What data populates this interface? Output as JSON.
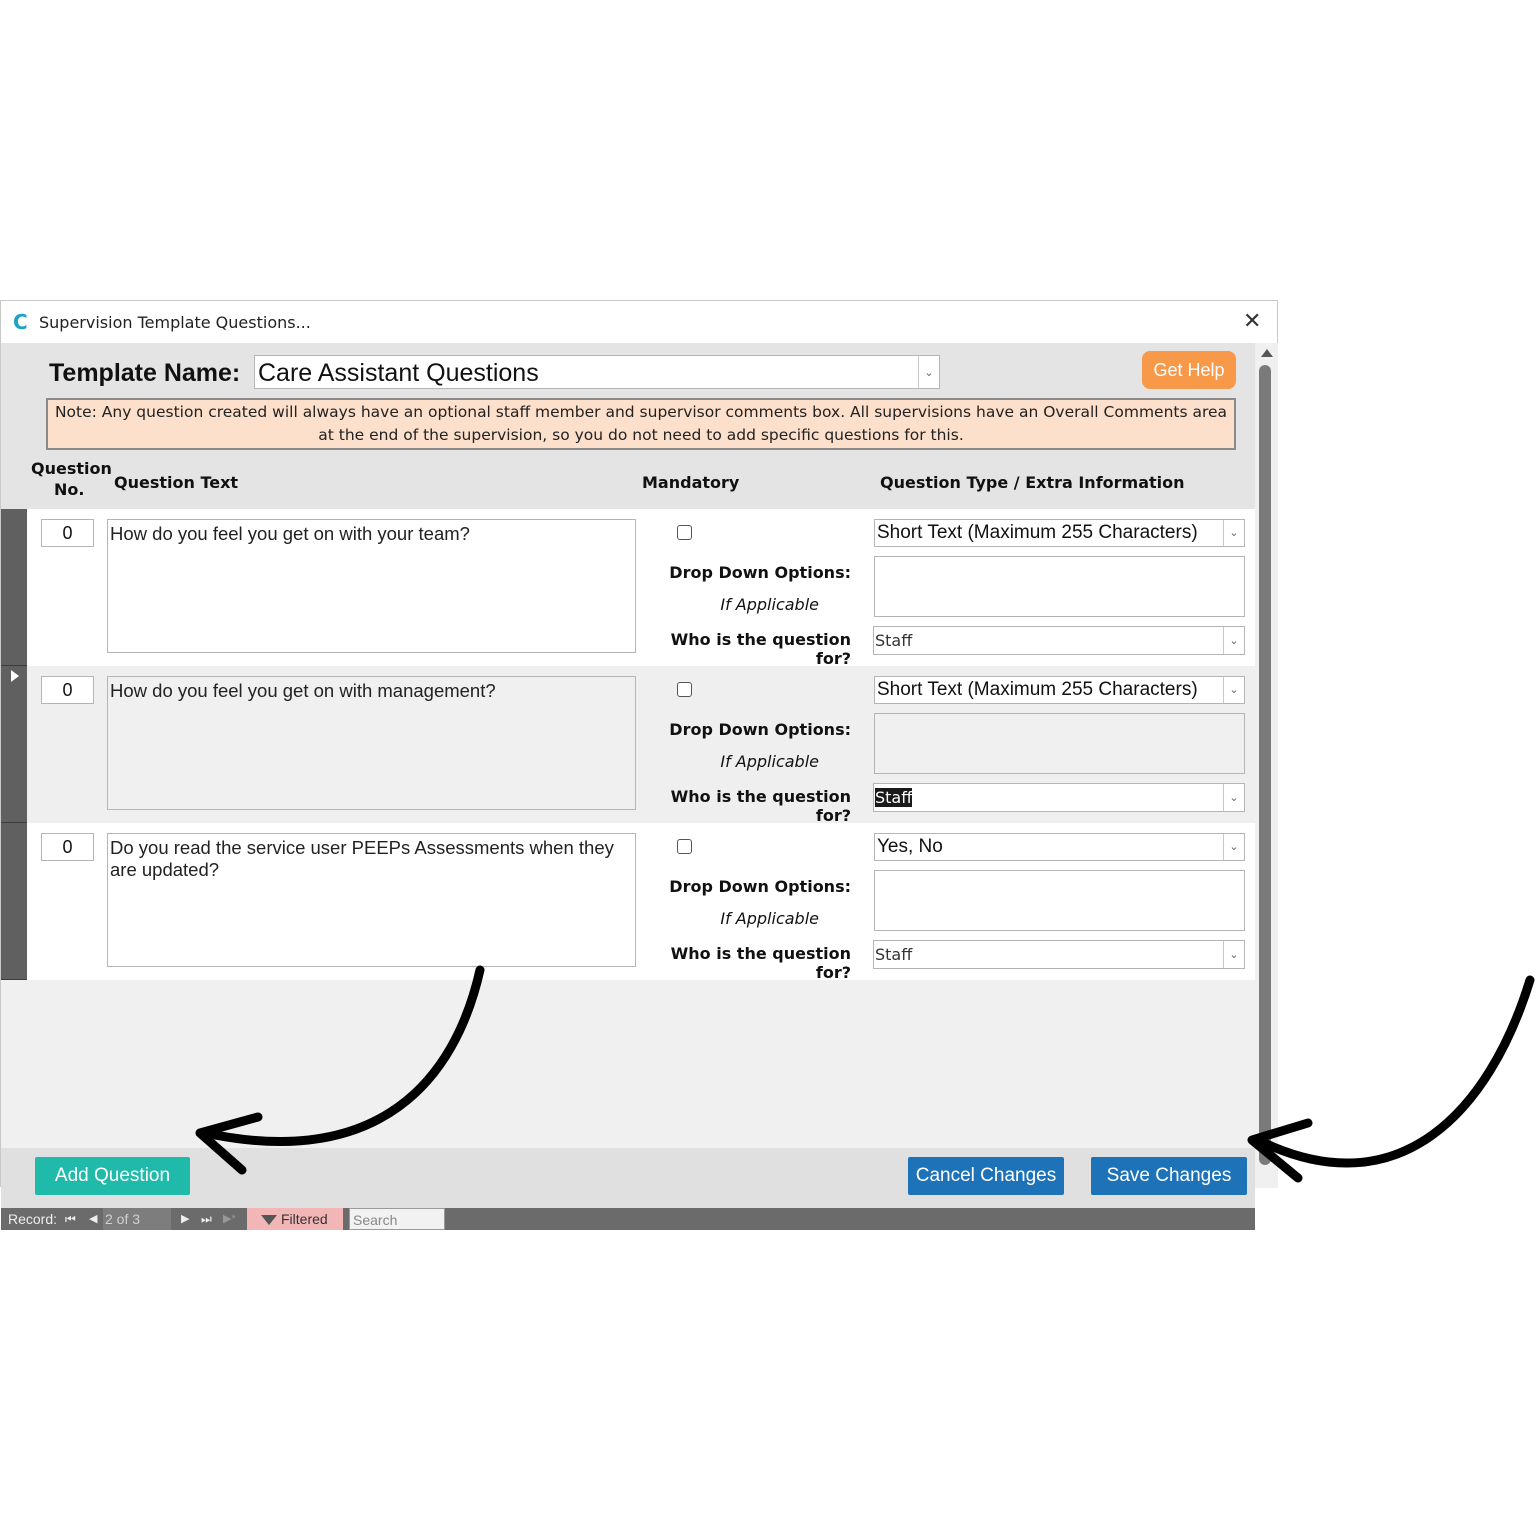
{
  "window": {
    "logo_letter": "C",
    "title": "Supervision Template Questions...",
    "close_glyph": "✕"
  },
  "header": {
    "template_label": "Template Name:",
    "template_value": "Care Assistant Questions",
    "help_label": "Get Help",
    "note": "Note: Any question created will always have an optional staff member and supervisor comments box.  All supervisions have an Overall Comments area at the end of the supervision, so you do not need to add specific questions for this.",
    "columns": {
      "question_no_1": "Question",
      "question_no_2": "No.",
      "question_text": "Question Text",
      "mandatory": "Mandatory",
      "question_type": "Question Type / Extra Information"
    }
  },
  "row_labels": {
    "dropdown_options": "Drop Down Options:",
    "if_applicable": "If Applicable",
    "who_for": "Who is the question for?"
  },
  "rows": [
    {
      "no": "0",
      "text": "How do you feel you get on with your team?",
      "mandatory": false,
      "type": "Short Text (Maximum 255 Characters)",
      "options": "",
      "who": "Staff"
    },
    {
      "no": "0",
      "text": "How do you feel you get on with management?",
      "mandatory": false,
      "type": "Short Text (Maximum 255 Characters)",
      "options": "",
      "who": "Staff"
    },
    {
      "no": "0",
      "text": "Do you read the service user PEEPs Assessments when they are updated?",
      "mandatory": false,
      "type": "Yes, No",
      "options": "",
      "who": "Staff"
    }
  ],
  "footer": {
    "add_label": "Add Question",
    "cancel_label": "Cancel Changes",
    "save_label": "Save Changes"
  },
  "navigation": {
    "record_label": "Record:",
    "position": "2 of 3",
    "filtered_label": "Filtered",
    "search_placeholder": "Search"
  },
  "colors": {
    "help_button": "#f8994a",
    "add_button": "#1fbaa9",
    "primary_button": "#1e73b8",
    "note_background": "#fde0cc",
    "filtered_background": "#f3b6b6"
  }
}
